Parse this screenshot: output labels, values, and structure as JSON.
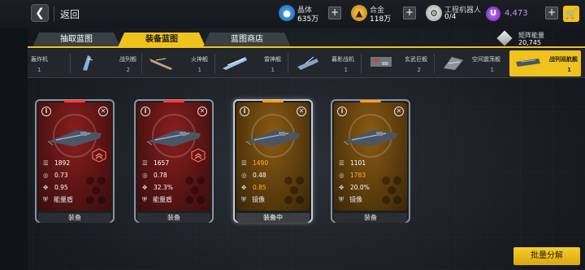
{
  "topbar": {
    "back_label": "返回",
    "resources": [
      {
        "name": "crystal",
        "label": "晶体",
        "value": "635万",
        "icon": "crystal-icon"
      },
      {
        "name": "alloy",
        "label": "合金",
        "value": "118万",
        "icon": "alloy-icon"
      },
      {
        "name": "robot",
        "label": "工程机器人",
        "value": "0/4",
        "icon": "robot-icon"
      }
    ],
    "currency_icon_label": "U",
    "currency_value": "4,473"
  },
  "tabs": [
    {
      "label": "抽取蓝图",
      "active": false
    },
    {
      "label": "装备蓝图",
      "active": true
    },
    {
      "label": "蓝图商店",
      "active": false
    }
  ],
  "matrix": {
    "label": "矩阵能量",
    "value": "20,745"
  },
  "categories": [
    {
      "name": "轰炸机",
      "count": "1",
      "selected": false
    },
    {
      "name": "战列舰",
      "count": "2",
      "selected": false
    },
    {
      "name": "火神舰",
      "count": "1",
      "selected": false
    },
    {
      "name": "雷神舰",
      "count": "1",
      "selected": false
    },
    {
      "name": "暮影战机",
      "count": "1",
      "selected": false
    },
    {
      "name": "玄武巨舰",
      "count": "2",
      "selected": false
    },
    {
      "name": "空间震荡舰",
      "count": "1",
      "selected": false
    },
    {
      "name": "战列巡航舰",
      "count": "1",
      "selected": true
    }
  ],
  "cards": [
    {
      "theme": "red",
      "stat1": "1892",
      "stat2": "0.73",
      "stat3": "0.95",
      "skill": "能量盾",
      "action": "装备",
      "hl": [],
      "has_rank": true
    },
    {
      "theme": "red",
      "stat1": "1657",
      "stat2": "0.78",
      "stat3": "32.3%",
      "skill": "能量盾",
      "action": "装备",
      "hl": [],
      "has_rank": true
    },
    {
      "theme": "gold",
      "stat1": "1490",
      "stat2": "0.48",
      "stat3": "0.85",
      "skill": "镜像",
      "action": "装备中",
      "hl": [
        1,
        3
      ],
      "has_rank": false
    },
    {
      "theme": "gold",
      "stat1": "1101",
      "stat2": "1783",
      "stat3": "20.0%",
      "skill": "镜像",
      "action": "装备",
      "hl": [
        2
      ],
      "has_rank": false
    }
  ],
  "batch_label": "批量分解",
  "colors": {
    "accent": "#f0c21c",
    "red_card": "#8a1f1f",
    "gold_card": "#8a5a14",
    "currency": "#d28bff"
  }
}
